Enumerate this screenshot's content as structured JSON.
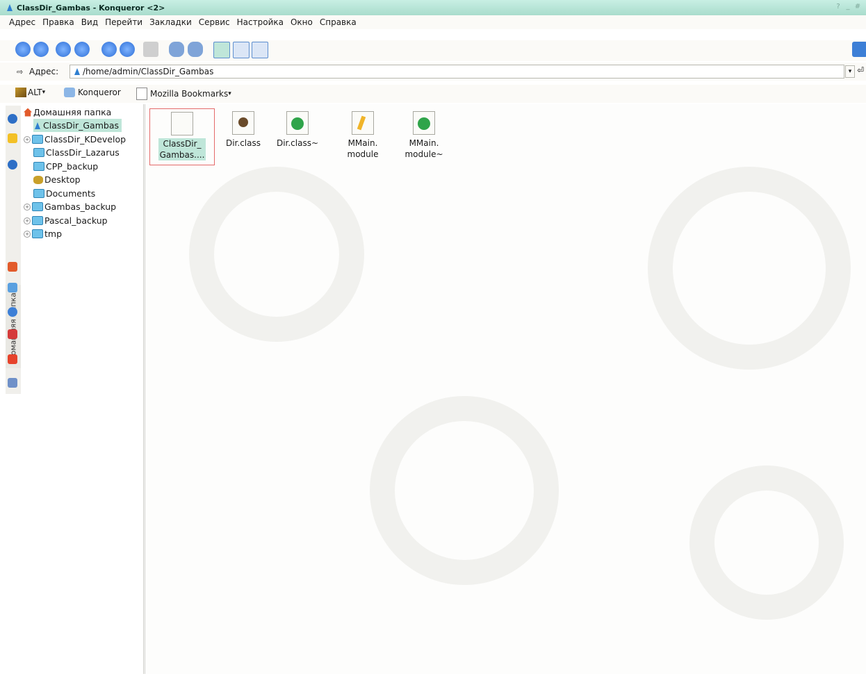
{
  "window": {
    "title": "ClassDir_Gambas - Konqueror <2>",
    "buttons": [
      "?",
      "_",
      "#"
    ]
  },
  "menubar": {
    "items": [
      "Адрес",
      "Правка",
      "Вид",
      "Перейти",
      "Закладки",
      "Сервис",
      "Настройка",
      "Окно",
      "Справка"
    ]
  },
  "toolbar": {
    "icons": [
      "back-icon",
      "forward-icon",
      "up-icon",
      "home-icon",
      "reload-icon",
      "stop-icon",
      "print-icon",
      "zoom-in-icon",
      "zoom-out-icon",
      "icon-view-icon",
      "detail-view-icon",
      "split-view-icon"
    ]
  },
  "location": {
    "label": "Адрес:",
    "value": "/home/admin/ClassDir_Gambas"
  },
  "bookmarks": {
    "items": [
      "ALT",
      "Konqueror",
      "Mozilla Bookmarks"
    ]
  },
  "sidebar": {
    "tab_label": "Домашняя папка"
  },
  "tree": {
    "root": "Домашняя папка",
    "items": [
      "ClassDir_Gambas",
      "ClassDir_KDevelop",
      "ClassDir_Lazarus",
      "CPP_backup",
      "Desktop",
      "Documents",
      "Gambas_backup",
      "Pascal_backup",
      "tmp"
    ]
  },
  "files": [
    {
      "line1": "ClassDir_",
      "line2": "Gambas....",
      "selected": true
    },
    {
      "line1": "Dir.class",
      "line2": ""
    },
    {
      "line1": "Dir.class~",
      "line2": ""
    },
    {
      "line1": "MMain.",
      "line2": "module"
    },
    {
      "line1": "MMain.",
      "line2": "module~"
    }
  ],
  "colors": {
    "titlebar": "#a9dccc",
    "selection": "#bfe6d9",
    "folder": "#6ec2ea"
  }
}
